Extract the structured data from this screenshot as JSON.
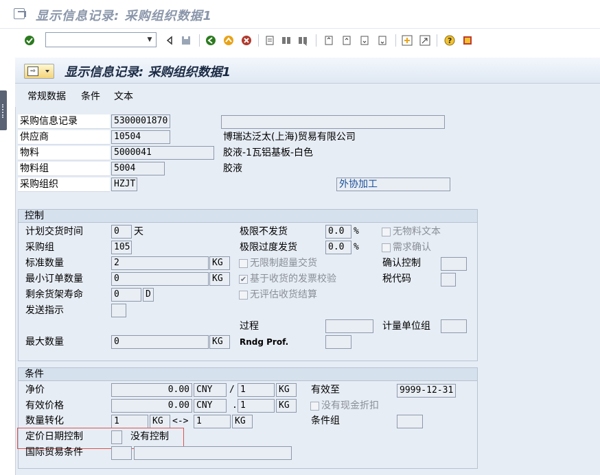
{
  "window": {
    "title": "显示信息记录: 采购组织数据1"
  },
  "toolbar": {
    "command_value": ""
  },
  "panel": {
    "title": "显示信息记录: 采购组织数据1",
    "nav_icon_glyph": "⇨"
  },
  "tabs": [
    "常规数据",
    "条件",
    "文本"
  ],
  "header": {
    "info_record_label": "采购信息记录",
    "info_record_value": "5300001870",
    "vendor_label": "供应商",
    "vendor_value": "10504",
    "vendor_name": "博瑞达泛太(上海)贸易有限公司",
    "material_label": "物料",
    "material_value": "5000041",
    "material_desc": "胶液-1瓦铝基板-白色",
    "material_group_label": "物料组",
    "material_group_value": "5004",
    "material_group_desc": "胶液",
    "purch_org_label": "采购组织",
    "purch_org_value": "HZJT",
    "purch_org_desc": "外协加工",
    "top_right_value": ""
  },
  "control": {
    "heading": "控制",
    "planned_delivery_label": "计划交货时间",
    "planned_delivery_value": "0",
    "planned_delivery_unit": "天",
    "purch_group_label": "采购组",
    "purch_group_value": "105",
    "std_qty_label": "标准数量",
    "std_qty_value": "2",
    "std_qty_unit": "KG",
    "min_order_label": "最小订单数量",
    "min_order_value": "0",
    "min_order_unit": "KG",
    "shelf_life_label": "剩余货架寿命",
    "shelf_life_value": "0",
    "shelf_life_unit": "D",
    "shipping_instr_label": "发送指示",
    "shipping_instr_value": "",
    "max_qty_label": "最大数量",
    "max_qty_value": "0",
    "max_qty_unit": "KG",
    "underdel_label": "极限不发货",
    "underdel_value": "0.0",
    "underdel_unit": "%",
    "overdel_label": "极限过度发货",
    "overdel_value": "0.0",
    "overdel_unit": "%",
    "unlimited_overdel_label": "无限制超量交货",
    "unlimited_overdel_checked": false,
    "gr_based_iv_label": "基于收货的发票校验",
    "gr_based_iv_checked": true,
    "no_eval_label": "无评估收货结算",
    "no_eval_checked": false,
    "procedure_label": "过程",
    "procedure_value": "",
    "rndg_label": "Rndg Prof.",
    "rndg_value": "",
    "no_mat_text_label": "无物料文本",
    "no_mat_text_checked": false,
    "ack_req_label": "需求确认",
    "ack_req_checked": false,
    "conf_ctrl_label": "确认控制",
    "conf_ctrl_value": "",
    "tax_code_label": "税代码",
    "tax_code_value": "",
    "uom_group_label": "计量单位组",
    "uom_group_value": ""
  },
  "conditions": {
    "heading": "条件",
    "net_price_label": "净价",
    "net_price_value": "0.00",
    "net_price_currency": "CNY",
    "net_price_slash": "/",
    "net_price_per": "1",
    "net_price_unit": "KG",
    "eff_price_label": "有效价格",
    "eff_price_value": "0.00",
    "eff_price_currency": "CNY",
    "eff_price_dot": ".",
    "eff_price_per": "1",
    "eff_price_unit": "KG",
    "qty_conv_label": "数量转化",
    "qty_conv_from": "1",
    "qty_conv_from_unit": "KG",
    "qty_conv_arrow": "<->",
    "qty_conv_to": "1",
    "qty_conv_to_unit": "KG",
    "valid_to_label": "有效至",
    "valid_to_value": "9999-12-31",
    "no_cash_disc_label": "没有现金折扣",
    "no_cash_disc_checked": false,
    "cond_group_label": "条件组",
    "cond_group_value": "",
    "pricing_date_label": "定价日期控制",
    "pricing_date_value": "",
    "pricing_date_desc": "没有控制",
    "incoterms_label": "国际贸易条件",
    "incoterms_value": "",
    "incoterms_desc": ""
  },
  "colors": {
    "accent_highlight": "#d9534f",
    "panel_bg": "#e7edf5",
    "text_blue": "#1c4f9a"
  }
}
